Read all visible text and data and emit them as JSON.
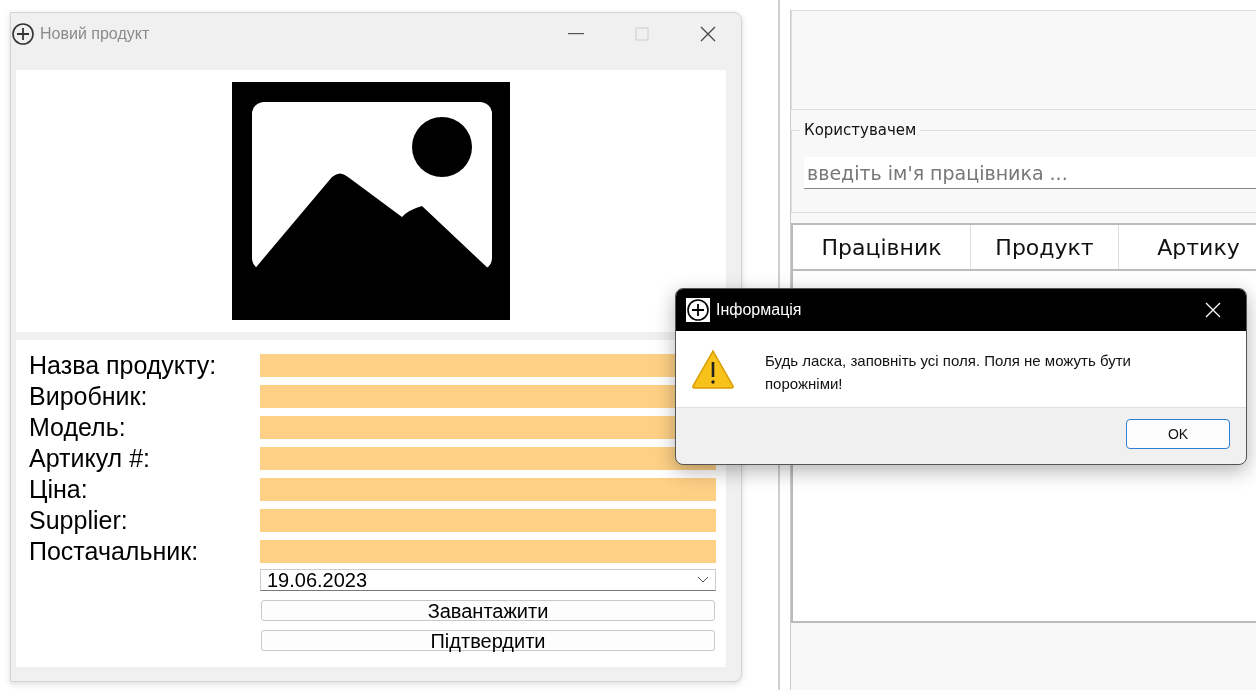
{
  "main_window": {
    "title": "Новий продукт",
    "fields": [
      {
        "label": "Назва продукту:"
      },
      {
        "label": "Виробник:"
      },
      {
        "label": "Модель:"
      },
      {
        "label": "Артикул #:"
      },
      {
        "label": "Ціна:"
      },
      {
        "label": "Supplier:"
      },
      {
        "label": "Постачальник:"
      }
    ],
    "date": "19.06.2023",
    "buttons": [
      "Завантажити",
      "Підтвердити"
    ]
  },
  "background_window": {
    "group_title": "Користувачем",
    "search": {
      "placeholder": "введіть ім'я працівника ..."
    },
    "table": {
      "columns": [
        "Працівник",
        "Продукт",
        "Артику"
      ]
    }
  },
  "dialog": {
    "title": "Інформація",
    "message": "Будь ласка, заповніть усі поля. Поля не можуть бути порожніми!",
    "button": "OK"
  }
}
